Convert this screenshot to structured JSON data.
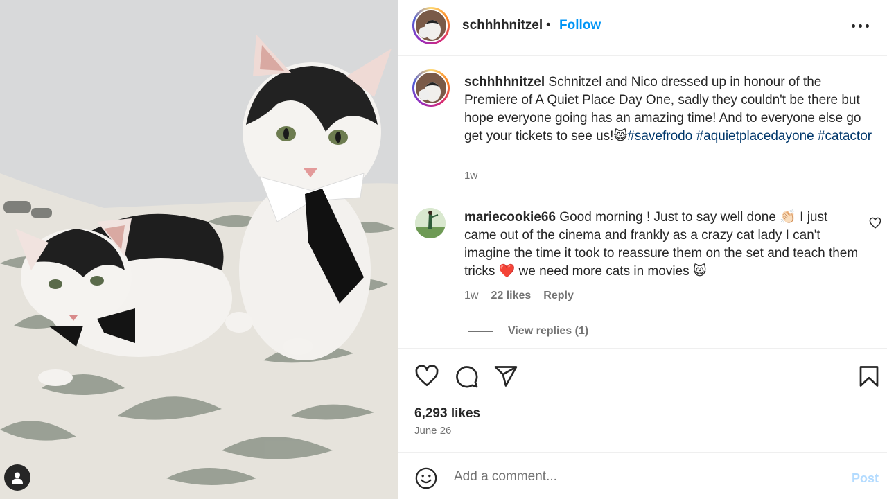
{
  "post": {
    "username": "schhhhnitzel",
    "separator": "•",
    "follow_label": "Follow",
    "caption": {
      "username": "schhhhnitzel",
      "text": " Schnitzel and Nico dressed up in honour of the Premiere of A Quiet Place Day One, sadly they couldn't be there but hope everyone going has an amazing time! And to everyone else go get your tickets to see us!",
      "emoji": "😸",
      "hashtags": [
        "#savefrodo",
        "#aquietplacedayone",
        "#catactor"
      ],
      "time": "1w"
    },
    "comment": {
      "username": "mariecookie66",
      "text_part1": " Good morning ! Just to say well done ",
      "emoji1": "👏🏻",
      "text_part2": " I just came out of the cinema and frankly as a crazy cat lady I can't imagine the time it took to reassure them on the set and teach them tricks ",
      "emoji2": "❤️",
      "text_part3": " we need more cats in movies ",
      "emoji3": "😸",
      "time": "1w",
      "likes": "22 likes",
      "reply_label": "Reply",
      "view_replies": "View replies (1)"
    },
    "likes_count": "6,293 likes",
    "date": "June 26",
    "add_comment": {
      "placeholder": "Add a comment...",
      "post_label": "Post"
    }
  },
  "icons": {
    "more": "more-options-icon",
    "like": "heart-icon",
    "comment": "comment-icon",
    "share": "share-icon",
    "save": "bookmark-icon",
    "emoji": "emoji-icon",
    "tags": "user-tag-icon"
  },
  "colors": {
    "accent": "#0095f6",
    "hashtag": "#00376b",
    "muted": "#737373",
    "post_disabled": "#b3dbff"
  }
}
